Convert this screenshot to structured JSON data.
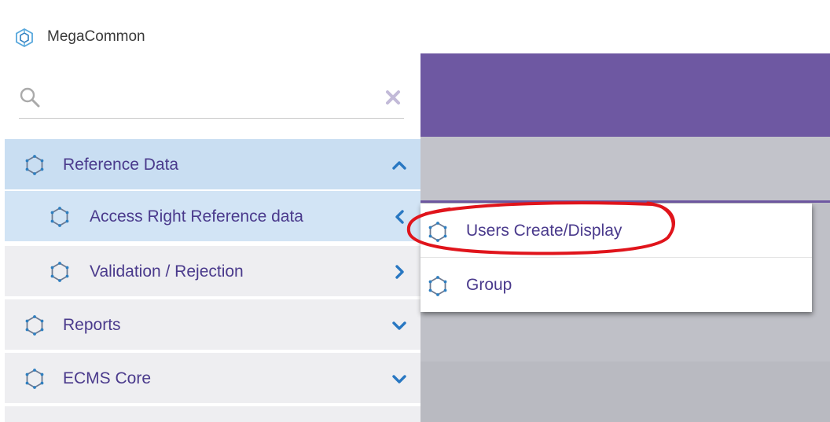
{
  "app": {
    "title": "MegaCommon"
  },
  "search": {
    "value": "",
    "placeholder": ""
  },
  "colors": {
    "header_purple": "#6e58a2",
    "menu_text": "#4a3a8c",
    "selected_bg": "#c9def2",
    "icon_blue": "#2f7fc0",
    "annotation_red": "#e0141b"
  },
  "menu": {
    "items": [
      {
        "label": "Reference Data",
        "icon": "hexagon-icon",
        "chevron": "chevron-up-icon"
      },
      {
        "label": "Access Right Reference data",
        "icon": "hexagon-icon",
        "chevron": "chevron-left-icon"
      },
      {
        "label": "Validation / Rejection",
        "icon": "hexagon-icon",
        "chevron": "chevron-right-icon"
      },
      {
        "label": "Reports",
        "icon": "hexagon-icon",
        "chevron": "chevron-down-icon"
      },
      {
        "label": "ECMS Core",
        "icon": "hexagon-icon",
        "chevron": "chevron-down-icon"
      }
    ]
  },
  "flyout": {
    "items": [
      {
        "label": "Users Create/Display",
        "icon": "hexagon-icon"
      },
      {
        "label": "Group",
        "icon": "hexagon-icon"
      }
    ]
  }
}
